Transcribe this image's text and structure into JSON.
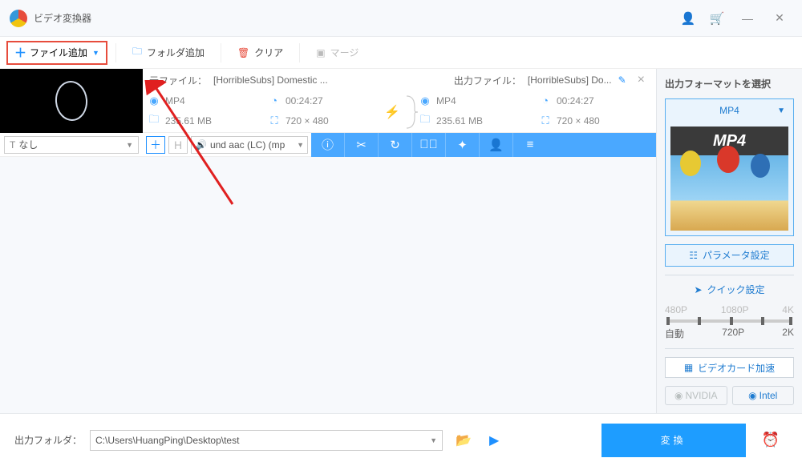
{
  "title": "ビデオ変換器",
  "toolbar": {
    "add": "ファイル追加",
    "folder": "フォルダ追加",
    "clear": "クリア",
    "merge": "マージ"
  },
  "item": {
    "src_label": "元ファイル：",
    "src_name": "[HorribleSubs] Domestic ...",
    "out_label": "出力ファイル：",
    "out_name": "[HorribleSubs] Do...",
    "src_fmt": "MP4",
    "src_dur": "00:24:27",
    "src_size": "235.61 MB",
    "src_res": "720 × 480",
    "out_fmt": "MP4",
    "out_dur": "00:24:27",
    "out_size": "235.61 MB",
    "out_res": "720 × 480"
  },
  "subtitle": {
    "value": "なし"
  },
  "audio": {
    "value": "und aac (LC) (mp"
  },
  "right": {
    "title": "出力フォーマットを選択",
    "fmt": "MP4",
    "fmt_badge": "MP4",
    "param": "パラメータ設定",
    "quick": "クイック設定",
    "s480": "480P",
    "s1080": "1080P",
    "s4k": "4K",
    "auto": "自動",
    "s720": "720P",
    "s2k": "2K",
    "gpu": "ビデオカード加速",
    "nvidia": "NVIDIA",
    "intel": "Intel"
  },
  "footer": {
    "label": "出力フォルダ：",
    "path": "C:\\Users\\HuangPing\\Desktop\\test",
    "convert": "変換"
  }
}
